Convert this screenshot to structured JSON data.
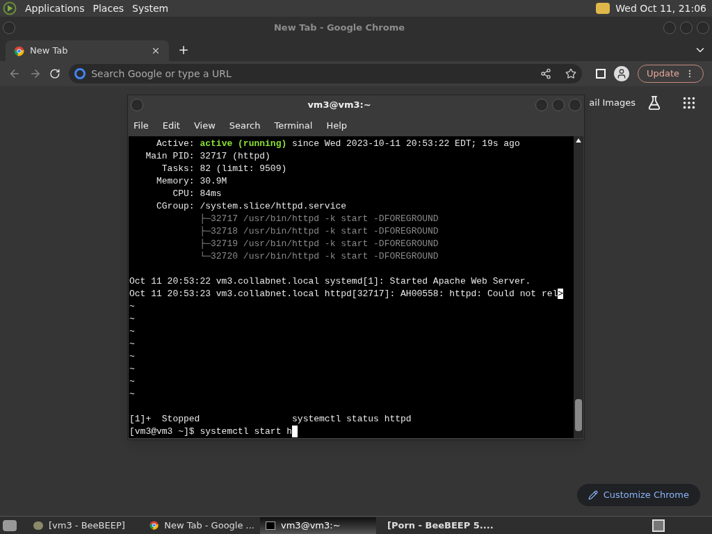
{
  "top_panel": {
    "menus": [
      "Applications",
      "Places",
      "System"
    ],
    "clock": "Wed Oct 11, 21:06"
  },
  "chrome": {
    "window_title": "New Tab - Google Chrome",
    "tabs": [
      {
        "label": "New Tab",
        "selected": true
      }
    ],
    "omnibox": {
      "placeholder": "Search Google or type a URL"
    },
    "update_label": "Update",
    "ntp_links": [
      "ail",
      "Images"
    ],
    "customize_label": "Customize Chrome"
  },
  "terminal": {
    "title": "vm3@vm3:~",
    "menus": [
      "File",
      "Edit",
      "View",
      "Search",
      "Terminal",
      "Help"
    ],
    "lines": [
      {
        "kind": "text",
        "segments": [
          {
            "kind": "normal",
            "text": "     Active: "
          },
          {
            "kind": "green",
            "text": "active (running)"
          },
          {
            "kind": "normal",
            "text": " since Wed 2023-10-11 20:53:22 EDT; 19s ago"
          }
        ]
      },
      {
        "kind": "text",
        "segments": [
          {
            "kind": "normal",
            "text": "   Main PID: 32717 (httpd)"
          }
        ]
      },
      {
        "kind": "text",
        "segments": [
          {
            "kind": "normal",
            "text": "      Tasks: 82 (limit: 9509)"
          }
        ]
      },
      {
        "kind": "text",
        "segments": [
          {
            "kind": "normal",
            "text": "     Memory: 30.9M"
          }
        ]
      },
      {
        "kind": "text",
        "segments": [
          {
            "kind": "normal",
            "text": "        CPU: 84ms"
          }
        ]
      },
      {
        "kind": "text",
        "segments": [
          {
            "kind": "normal",
            "text": "     CGroup: /system.slice/httpd.service"
          }
        ]
      },
      {
        "kind": "text",
        "segments": [
          {
            "kind": "dim",
            "text": "             ├─32717 /usr/bin/httpd -k start -DFOREGROUND"
          }
        ]
      },
      {
        "kind": "text",
        "segments": [
          {
            "kind": "dim",
            "text": "             ├─32718 /usr/bin/httpd -k start -DFOREGROUND"
          }
        ]
      },
      {
        "kind": "text",
        "segments": [
          {
            "kind": "dim",
            "text": "             ├─32719 /usr/bin/httpd -k start -DFOREGROUND"
          }
        ]
      },
      {
        "kind": "text",
        "segments": [
          {
            "kind": "dim",
            "text": "             └─32720 /usr/bin/httpd -k start -DFOREGROUND"
          }
        ]
      },
      {
        "kind": "blank"
      },
      {
        "kind": "text",
        "segments": [
          {
            "kind": "normal",
            "text": "Oct 11 20:53:22 vm3.collabnet.local systemd[1]: Started Apache Web Server."
          }
        ]
      },
      {
        "kind": "text",
        "segments": [
          {
            "kind": "normal",
            "text": "Oct 11 20:53:23 vm3.collabnet.local httpd[32717]: AH00558: httpd: Could not rel"
          },
          {
            "kind": "overflow",
            "text": ">"
          }
        ]
      },
      {
        "kind": "text",
        "segments": [
          {
            "kind": "normal",
            "text": "~"
          }
        ]
      },
      {
        "kind": "text",
        "segments": [
          {
            "kind": "normal",
            "text": "~"
          }
        ]
      },
      {
        "kind": "text",
        "segments": [
          {
            "kind": "normal",
            "text": "~"
          }
        ]
      },
      {
        "kind": "text",
        "segments": [
          {
            "kind": "normal",
            "text": "~"
          }
        ]
      },
      {
        "kind": "text",
        "segments": [
          {
            "kind": "normal",
            "text": "~"
          }
        ]
      },
      {
        "kind": "text",
        "segments": [
          {
            "kind": "normal",
            "text": "~"
          }
        ]
      },
      {
        "kind": "text",
        "segments": [
          {
            "kind": "normal",
            "text": "~"
          }
        ]
      },
      {
        "kind": "text",
        "segments": [
          {
            "kind": "normal",
            "text": "~"
          }
        ]
      },
      {
        "kind": "blank"
      },
      {
        "kind": "text",
        "segments": [
          {
            "kind": "normal",
            "text": "[1]+  Stopped                 systemctl status httpd"
          }
        ]
      },
      {
        "kind": "prompt",
        "segments": [
          {
            "kind": "normal",
            "text": "[vm3@vm3 ~]$ systemctl start h"
          }
        ]
      }
    ]
  },
  "taskbar": [
    {
      "kind": "beebeep",
      "label": "[vm3 - BeeBEEP]",
      "selected": false,
      "urgent": false
    },
    {
      "kind": "chrome",
      "label": "New Tab - Google ...",
      "selected": false,
      "urgent": false
    },
    {
      "kind": "terminal",
      "label": "vm3@vm3:~",
      "selected": true,
      "urgent": false
    },
    {
      "kind": "beebeep-msg",
      "label": "[Porn - BeeBEEP 5....",
      "selected": false,
      "urgent": true
    }
  ]
}
